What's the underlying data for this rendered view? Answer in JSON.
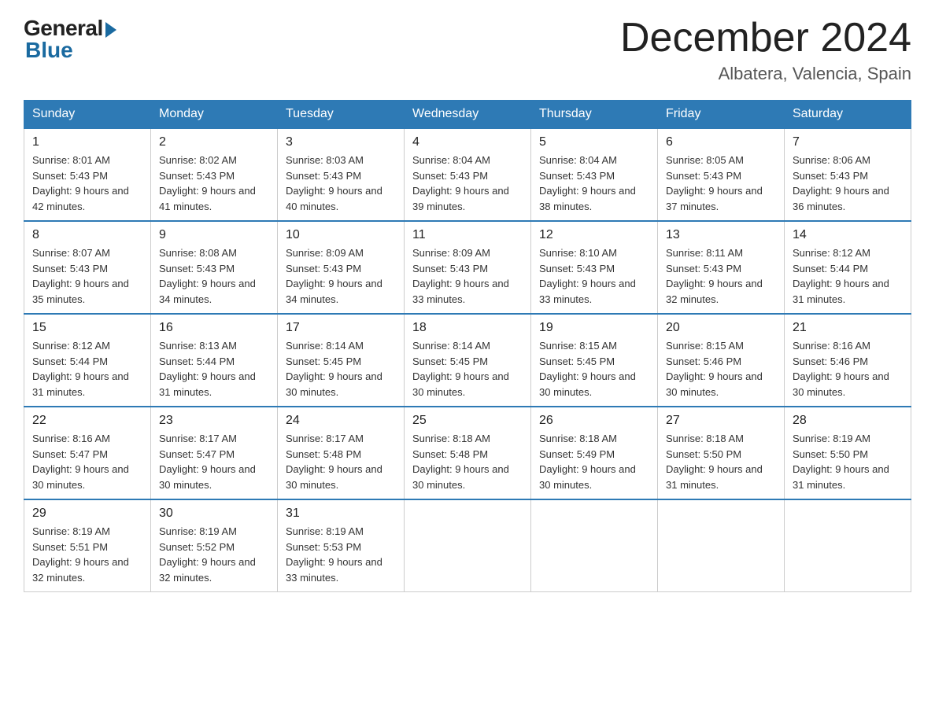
{
  "header": {
    "logo_general": "General",
    "logo_blue": "Blue",
    "month_title": "December 2024",
    "location": "Albatera, Valencia, Spain"
  },
  "weekdays": [
    "Sunday",
    "Monday",
    "Tuesday",
    "Wednesday",
    "Thursday",
    "Friday",
    "Saturday"
  ],
  "weeks": [
    [
      {
        "day": "1",
        "sunrise": "8:01 AM",
        "sunset": "5:43 PM",
        "daylight": "9 hours and 42 minutes."
      },
      {
        "day": "2",
        "sunrise": "8:02 AM",
        "sunset": "5:43 PM",
        "daylight": "9 hours and 41 minutes."
      },
      {
        "day": "3",
        "sunrise": "8:03 AM",
        "sunset": "5:43 PM",
        "daylight": "9 hours and 40 minutes."
      },
      {
        "day": "4",
        "sunrise": "8:04 AM",
        "sunset": "5:43 PM",
        "daylight": "9 hours and 39 minutes."
      },
      {
        "day": "5",
        "sunrise": "8:04 AM",
        "sunset": "5:43 PM",
        "daylight": "9 hours and 38 minutes."
      },
      {
        "day": "6",
        "sunrise": "8:05 AM",
        "sunset": "5:43 PM",
        "daylight": "9 hours and 37 minutes."
      },
      {
        "day": "7",
        "sunrise": "8:06 AM",
        "sunset": "5:43 PM",
        "daylight": "9 hours and 36 minutes."
      }
    ],
    [
      {
        "day": "8",
        "sunrise": "8:07 AM",
        "sunset": "5:43 PM",
        "daylight": "9 hours and 35 minutes."
      },
      {
        "day": "9",
        "sunrise": "8:08 AM",
        "sunset": "5:43 PM",
        "daylight": "9 hours and 34 minutes."
      },
      {
        "day": "10",
        "sunrise": "8:09 AM",
        "sunset": "5:43 PM",
        "daylight": "9 hours and 34 minutes."
      },
      {
        "day": "11",
        "sunrise": "8:09 AM",
        "sunset": "5:43 PM",
        "daylight": "9 hours and 33 minutes."
      },
      {
        "day": "12",
        "sunrise": "8:10 AM",
        "sunset": "5:43 PM",
        "daylight": "9 hours and 33 minutes."
      },
      {
        "day": "13",
        "sunrise": "8:11 AM",
        "sunset": "5:43 PM",
        "daylight": "9 hours and 32 minutes."
      },
      {
        "day": "14",
        "sunrise": "8:12 AM",
        "sunset": "5:44 PM",
        "daylight": "9 hours and 31 minutes."
      }
    ],
    [
      {
        "day": "15",
        "sunrise": "8:12 AM",
        "sunset": "5:44 PM",
        "daylight": "9 hours and 31 minutes."
      },
      {
        "day": "16",
        "sunrise": "8:13 AM",
        "sunset": "5:44 PM",
        "daylight": "9 hours and 31 minutes."
      },
      {
        "day": "17",
        "sunrise": "8:14 AM",
        "sunset": "5:45 PM",
        "daylight": "9 hours and 30 minutes."
      },
      {
        "day": "18",
        "sunrise": "8:14 AM",
        "sunset": "5:45 PM",
        "daylight": "9 hours and 30 minutes."
      },
      {
        "day": "19",
        "sunrise": "8:15 AM",
        "sunset": "5:45 PM",
        "daylight": "9 hours and 30 minutes."
      },
      {
        "day": "20",
        "sunrise": "8:15 AM",
        "sunset": "5:46 PM",
        "daylight": "9 hours and 30 minutes."
      },
      {
        "day": "21",
        "sunrise": "8:16 AM",
        "sunset": "5:46 PM",
        "daylight": "9 hours and 30 minutes."
      }
    ],
    [
      {
        "day": "22",
        "sunrise": "8:16 AM",
        "sunset": "5:47 PM",
        "daylight": "9 hours and 30 minutes."
      },
      {
        "day": "23",
        "sunrise": "8:17 AM",
        "sunset": "5:47 PM",
        "daylight": "9 hours and 30 minutes."
      },
      {
        "day": "24",
        "sunrise": "8:17 AM",
        "sunset": "5:48 PM",
        "daylight": "9 hours and 30 minutes."
      },
      {
        "day": "25",
        "sunrise": "8:18 AM",
        "sunset": "5:48 PM",
        "daylight": "9 hours and 30 minutes."
      },
      {
        "day": "26",
        "sunrise": "8:18 AM",
        "sunset": "5:49 PM",
        "daylight": "9 hours and 30 minutes."
      },
      {
        "day": "27",
        "sunrise": "8:18 AM",
        "sunset": "5:50 PM",
        "daylight": "9 hours and 31 minutes."
      },
      {
        "day": "28",
        "sunrise": "8:19 AM",
        "sunset": "5:50 PM",
        "daylight": "9 hours and 31 minutes."
      }
    ],
    [
      {
        "day": "29",
        "sunrise": "8:19 AM",
        "sunset": "5:51 PM",
        "daylight": "9 hours and 32 minutes."
      },
      {
        "day": "30",
        "sunrise": "8:19 AM",
        "sunset": "5:52 PM",
        "daylight": "9 hours and 32 minutes."
      },
      {
        "day": "31",
        "sunrise": "8:19 AM",
        "sunset": "5:53 PM",
        "daylight": "9 hours and 33 minutes."
      },
      null,
      null,
      null,
      null
    ]
  ]
}
